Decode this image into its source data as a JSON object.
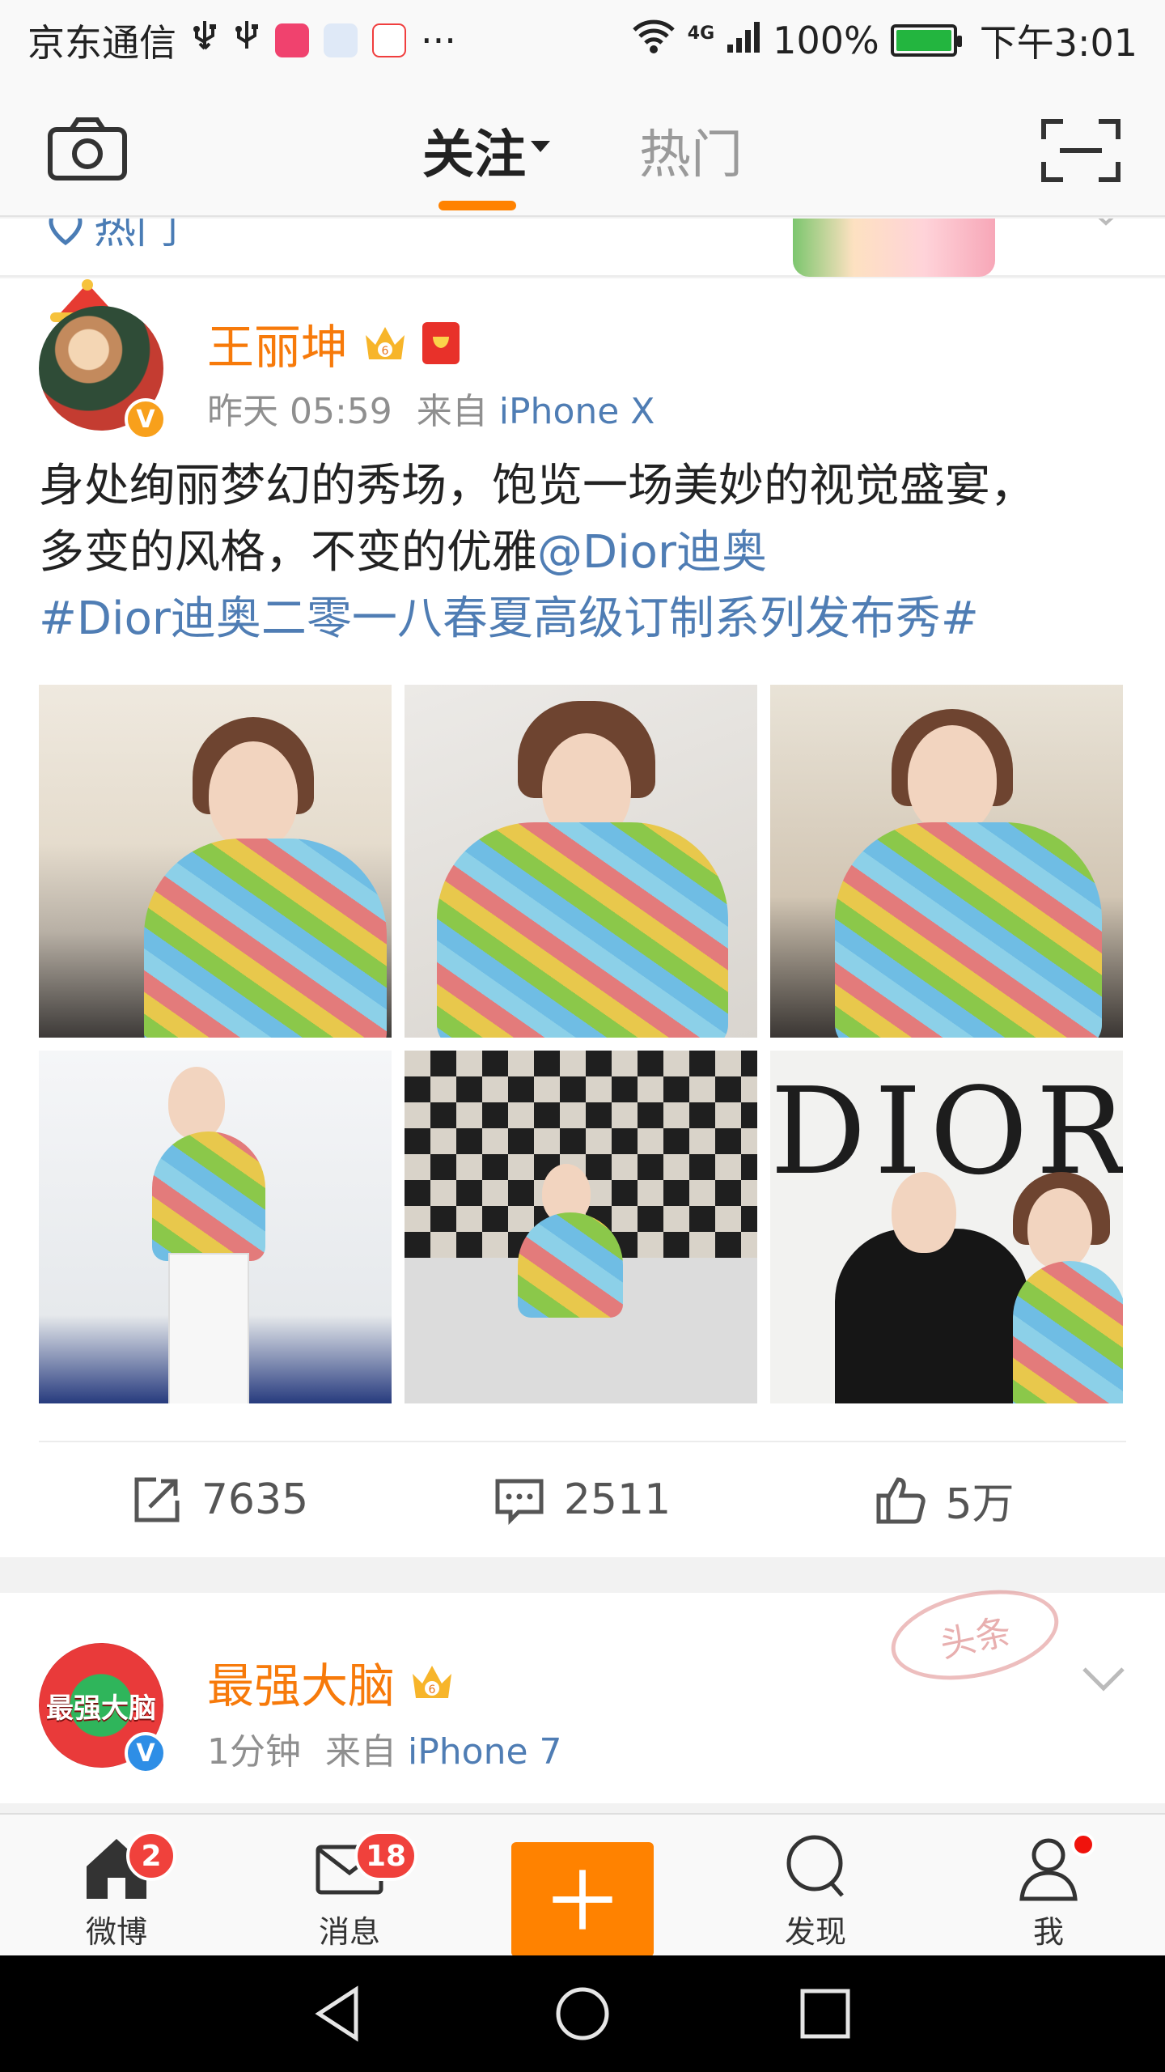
{
  "status_bar": {
    "carrier": "京东通信",
    "battery": "100%",
    "time": "下午3:01",
    "network": "4G",
    "battery_level": 1.0
  },
  "header": {
    "tabs": [
      {
        "label": "关注",
        "active": true
      },
      {
        "label": "热门",
        "active": false
      }
    ]
  },
  "previous_post": {
    "hot_link": "热门"
  },
  "posts": [
    {
      "author": "王丽坤",
      "time": "昨天 05:59",
      "source_prefix": "来自",
      "device": "iPhone X",
      "text_line1": "身处绚丽梦幻的秀场，饱览一场美妙的视觉盛宴，",
      "text_line2_plain": "多变的风格，不变的优雅",
      "mention": "@Dior迪奥",
      "hashtag": "#Dior迪奥二零一八春夏高级订制系列发布秀#",
      "repost_count": "7635",
      "comment_count": "2511",
      "like_count": "5万",
      "verified_badge": "V",
      "images": 6
    },
    {
      "author": "最强大脑",
      "time": "1分钟",
      "source_prefix": "来自",
      "device": "iPhone 7",
      "verified_badge": "V",
      "avatar_text": "最强大脑",
      "stamp_text": "头条"
    }
  ],
  "tabbar": {
    "items": [
      {
        "label": "微博",
        "badge": "2"
      },
      {
        "label": "消息",
        "badge": "18"
      },
      {
        "label": ""
      },
      {
        "label": "发现"
      },
      {
        "label": "我"
      }
    ]
  },
  "colors": {
    "accent": "#ff8200",
    "username": "#f77a0a",
    "link": "#4f7db4",
    "badge_red": "#f0413c"
  }
}
